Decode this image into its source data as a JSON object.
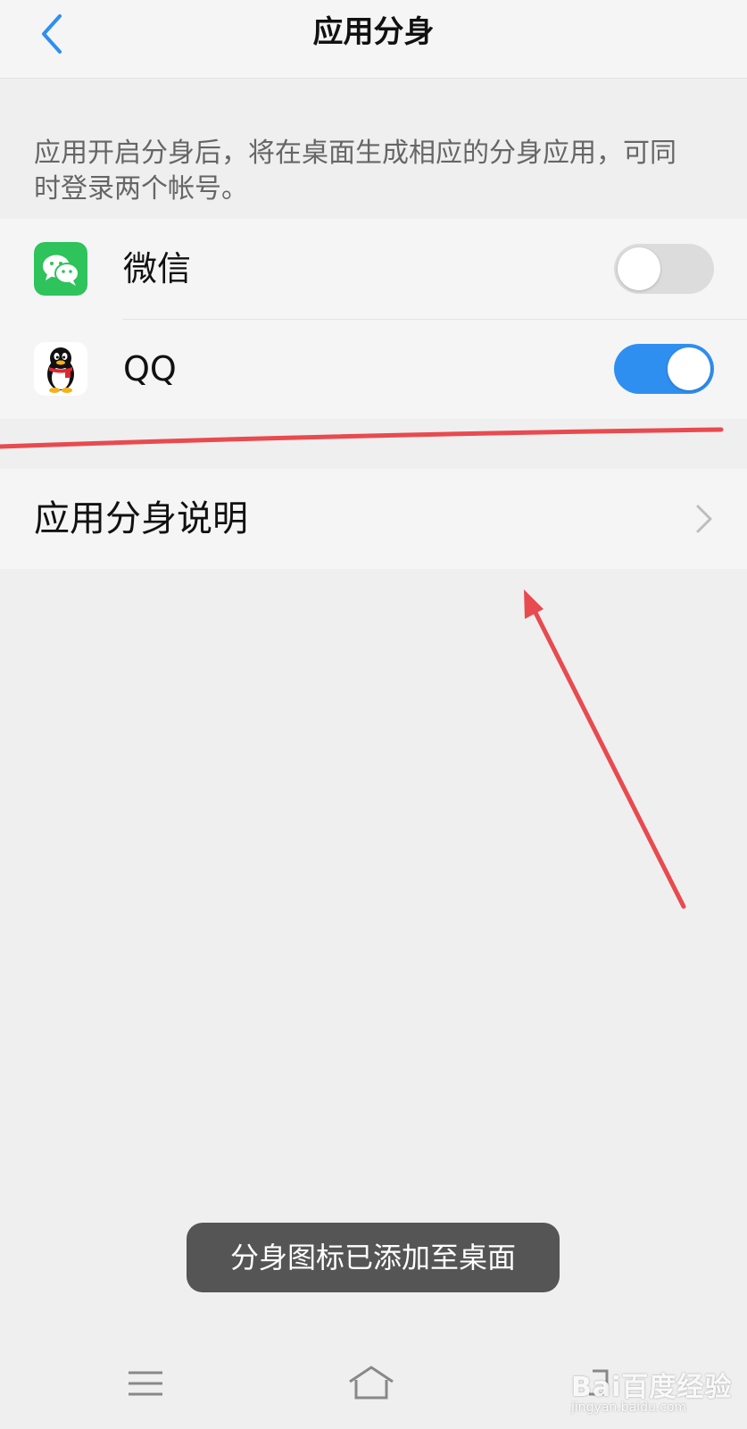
{
  "header": {
    "title": "应用分身",
    "back_icon": "chevron-left-icon"
  },
  "description": "应用开启分身后，将在桌面生成相应的分身应用，可同时登录两个帐号。",
  "apps": [
    {
      "name": "微信",
      "icon": "wechat-icon",
      "enabled": false
    },
    {
      "name": "QQ",
      "icon": "qq-penguin-icon",
      "enabled": true
    }
  ],
  "explanation": {
    "label": "应用分身说明",
    "icon": "chevron-right-icon"
  },
  "toast": "分身图标已添加至桌面",
  "navbar": {
    "icons": [
      "menu-icon",
      "home-icon",
      "back-icon"
    ]
  },
  "watermark": {
    "brand": "Bai百度经验",
    "url": "jingyan.baidu.com"
  },
  "colors": {
    "accent": "#2f8ff0",
    "annotation": "#e84a4f",
    "wechat_green": "#2ec35b"
  }
}
